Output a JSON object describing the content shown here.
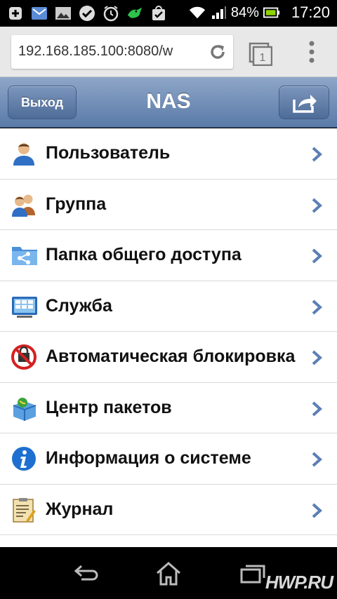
{
  "status_bar": {
    "battery_percent": "84%",
    "time": "17:20",
    "icons": [
      "plus-icon",
      "mail-icon",
      "image-icon",
      "check-circle-icon",
      "alarm-clock-icon",
      "crocodile-icon",
      "bag-check-icon",
      "wifi-icon",
      "signal-icon",
      "battery-icon"
    ]
  },
  "browser": {
    "url": "192.168.185.100:8080/w"
  },
  "header": {
    "exit_label": "Выход",
    "title": "NAS"
  },
  "menu": {
    "items": [
      {
        "label": "Пользователь",
        "icon": "user-icon"
      },
      {
        "label": "Группа",
        "icon": "group-icon"
      },
      {
        "label": "Папка общего доступа",
        "icon": "shared-folder-icon"
      },
      {
        "label": "Служба",
        "icon": "service-icon"
      },
      {
        "label": "Автоматическая блокировка",
        "icon": "auto-block-icon"
      },
      {
        "label": "Центр пакетов",
        "icon": "package-center-icon"
      },
      {
        "label": "Информация о системе",
        "icon": "info-icon"
      },
      {
        "label": "Журнал",
        "icon": "log-icon"
      }
    ]
  },
  "watermark": "HWP.RU",
  "colors": {
    "header_top": "#8ea6c8",
    "header_bottom": "#5a7aa8",
    "chevron": "#5b7fb5"
  }
}
